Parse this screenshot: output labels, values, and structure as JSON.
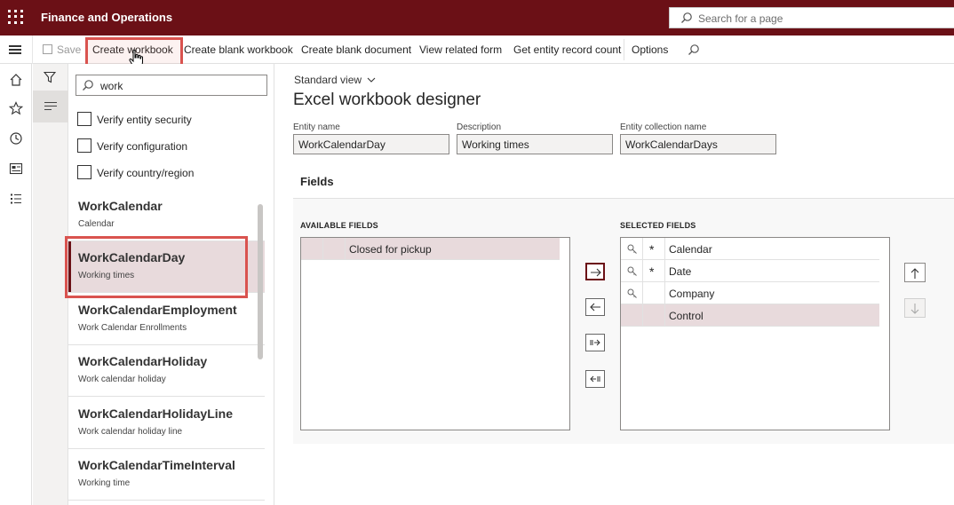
{
  "topbar": {
    "app_title": "Finance and Operations",
    "search_placeholder": "Search for a page"
  },
  "actionpane": {
    "save_label": "Save",
    "create_workbook_label": "Create workbook",
    "create_blank_workbook_label": "Create blank workbook",
    "create_blank_document_label": "Create blank document",
    "view_related_form_label": "View related form",
    "get_entity_record_count_label": "Get entity record count",
    "options_label": "Options"
  },
  "listpanel": {
    "search_value": "work",
    "checks": [
      {
        "label": "Verify entity security",
        "checked": false
      },
      {
        "label": "Verify configuration",
        "checked": false
      },
      {
        "label": "Verify country/region",
        "checked": false
      }
    ],
    "items": [
      {
        "title": "WorkCalendar",
        "subtitle": "Calendar",
        "selected": false
      },
      {
        "title": "WorkCalendarDay",
        "subtitle": "Working times",
        "selected": true
      },
      {
        "title": "WorkCalendarEmployment",
        "subtitle": "Work Calendar Enrollments",
        "selected": false
      },
      {
        "title": "WorkCalendarHoliday",
        "subtitle": "Work calendar holiday",
        "selected": false
      },
      {
        "title": "WorkCalendarHolidayLine",
        "subtitle": "Work calendar holiday line",
        "selected": false
      },
      {
        "title": "WorkCalendarTimeInterval",
        "subtitle": "Working time",
        "selected": false
      }
    ]
  },
  "main": {
    "view_selector": "Standard view",
    "page_title": "Excel workbook designer",
    "entity_name_label": "Entity name",
    "entity_name_value": "WorkCalendarDay",
    "description_label": "Description",
    "description_value": "Working times",
    "collection_label": "Entity collection name",
    "collection_value": "WorkCalendarDays",
    "fields_header": "Fields",
    "available_label": "AVAILABLE FIELDS",
    "selected_label": "SELECTED FIELDS",
    "available_fields": [
      "Closed for pickup"
    ],
    "selected_fields": [
      {
        "key_icon": true,
        "required_mark": "*",
        "name": "Calendar",
        "selected": false
      },
      {
        "key_icon": true,
        "required_mark": "*",
        "name": "Date",
        "selected": false
      },
      {
        "key_icon": true,
        "required_mark": "",
        "name": "Company",
        "selected": false
      },
      {
        "key_icon": false,
        "required_mark": "",
        "name": "Control",
        "selected": true
      }
    ]
  },
  "colors": {
    "brand": "#6b1016",
    "selection": "#e8dadc",
    "highlight_box": "#d9534f"
  }
}
